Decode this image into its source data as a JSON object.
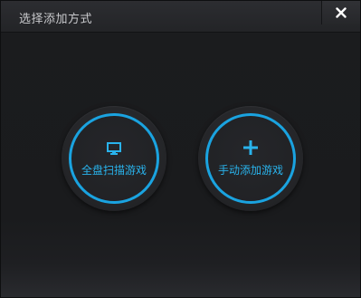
{
  "dialog": {
    "title": "选择添加方式",
    "close_icon": "close-icon"
  },
  "actions": [
    {
      "label": "全盘扫描游戏",
      "icon": "monitor-icon"
    },
    {
      "label": "手动添加游戏",
      "icon": "plus-icon"
    }
  ],
  "colors": {
    "accent": "#1aa3e0",
    "label": "#29b3ec",
    "background": "#1a1b1d",
    "titlebar": "#2a2b2f"
  }
}
